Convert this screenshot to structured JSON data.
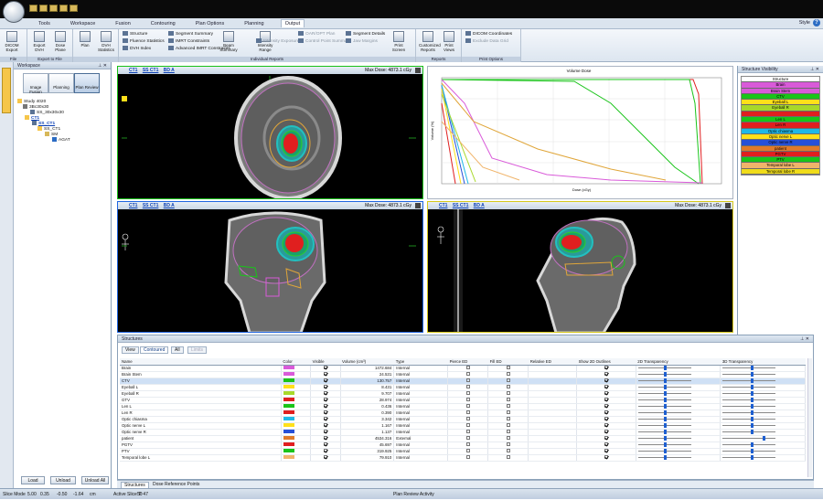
{
  "titlebar": {
    "qat_icons": [
      "save-icon",
      "open-icon",
      "undo-icon",
      "redo-icon",
      "print-icon"
    ]
  },
  "menu": {
    "tabs": [
      "Tools",
      "Workspace",
      "Fusion",
      "Contouring",
      "Plan Options",
      "Planning",
      "Output"
    ],
    "active": "Output",
    "style_label": "Style",
    "help": "?"
  },
  "ribbon": {
    "groups": [
      {
        "label": "File",
        "buttons": [
          "DICOM Export"
        ]
      },
      {
        "label": "Export to File",
        "buttons": [
          "Export DVH",
          "Dose Plane"
        ]
      },
      {
        "label": "",
        "buttons": [
          "Plan",
          "DVH Statistics"
        ]
      },
      {
        "label": "Individual Reports",
        "small": [
          "Structure",
          "Fluence Statistics",
          "DVH Index",
          "Segment Summary",
          "IMRT Constraints",
          "Advanced IMRT Constraints",
          "Beam Summary",
          "Intensity Range",
          "Intensity Exposure",
          "OAR/OPT Plan",
          "Control Point Summary",
          "Segment Details",
          "Jaw Margins",
          "Print Screen"
        ]
      },
      {
        "label": "Reports",
        "buttons": [
          "Customized Reports",
          "Print Views"
        ]
      },
      {
        "label": "Print Options",
        "small": [
          "DICOM Coordinates",
          "Exclude Data Grid"
        ]
      }
    ]
  },
  "workspace": {
    "title": "Workspace",
    "modes": [
      "Image Fusion",
      "Planning",
      "Plan Review"
    ],
    "active_mode": "Plan Review",
    "tree": [
      "Study 4020",
      "3Bc30x30",
      "SS_30x30x30",
      "CT1",
      "SS_CT1",
      "SS_CT1",
      "SM",
      "AGAT"
    ],
    "footer": [
      "Load",
      "Unload",
      "Unload All"
    ]
  },
  "views": {
    "axial": {
      "links": [
        "CT1",
        "SS CT1",
        "BD A"
      ],
      "max_dose": "Max Dose: 4873.1 cGy"
    },
    "coronal": {
      "links": [
        "CT1",
        "SS CT1",
        "BD A"
      ],
      "max_dose": "Max Dose: 4873.1 cGy"
    },
    "sagittal": {
      "links": [
        "CT1",
        "SS CT1",
        "BD A"
      ],
      "max_dose": "Max Dose: 4873.1 cGy"
    }
  },
  "dvh": {
    "title": "Volume Dose",
    "x_label": "Dose (cGy)",
    "y_label": "Volume (%)"
  },
  "structure_visibility": {
    "title": "Structure Visibility",
    "header": "Structure",
    "rows": [
      {
        "name": "Brain",
        "color": "#d95ad9"
      },
      {
        "name": "Brain Stem",
        "color": "#d95ad9"
      },
      {
        "name": "CTV",
        "color": "#19c419"
      },
      {
        "name": "Eyeball L",
        "color": "#ffe01a"
      },
      {
        "name": "Eyeball R",
        "color": "#a8d82a"
      },
      {
        "name": "",
        "color": "#e01f1f"
      },
      {
        "name": "Len L",
        "color": "#19c419"
      },
      {
        "name": "Len R",
        "color": "#e01f1f"
      },
      {
        "name": "Optic chiasma",
        "color": "#1fb8e6"
      },
      {
        "name": "Optic nerve L",
        "color": "#ffe01a"
      },
      {
        "name": "Optic nerve R",
        "color": "#2650d8"
      },
      {
        "name": "patient",
        "color": "#e07a2a"
      },
      {
        "name": "PGTV",
        "color": "#e01f1f"
      },
      {
        "name": "PTV",
        "color": "#19c419"
      },
      {
        "name": "Temporal lobe L",
        "color": "#f0b46a"
      },
      {
        "name": "Temporal lobe R",
        "color": "#f0dc1a"
      }
    ]
  },
  "structures": {
    "title": "Structures",
    "tabs": [
      "View",
      "Contoured",
      "All",
      "Limits"
    ],
    "active_tab": "Contoured",
    "columns": [
      "Name",
      "Color",
      "Visible",
      "Volume (cm³)",
      "Type",
      "Pierce ED",
      "Fill ED",
      "Relative ED",
      "Show 2D Outlines",
      "2D Transparency",
      "3D Transparency"
    ],
    "rows": [
      {
        "name": "Brain",
        "color": "#d95ad9",
        "vol": "1472.684",
        "type": "Internal",
        "t2": 0.52,
        "t3": 0.55
      },
      {
        "name": "Brain Stem",
        "color": "#d95ad9",
        "vol": "24.531",
        "type": "Internal",
        "t2": 0.52,
        "t3": 0.55
      },
      {
        "name": "CTV",
        "color": "#19c419",
        "vol": "130.757",
        "type": "Internal",
        "t2": 0.52,
        "t3": 0.55
      },
      {
        "name": "Eyeball L",
        "color": "#ffe01a",
        "vol": "8.431",
        "type": "Internal",
        "t2": 0.52,
        "t3": 0.55
      },
      {
        "name": "Eyeball R",
        "color": "#a8d82a",
        "vol": "9.707",
        "type": "Internal",
        "t2": 0.52,
        "t3": 0.55
      },
      {
        "name": "GTV",
        "color": "#e01f1f",
        "vol": "28.974",
        "type": "Internal",
        "t2": 0.52,
        "t3": 0.55
      },
      {
        "name": "Len L",
        "color": "#19c419",
        "vol": "0.436",
        "type": "Internal",
        "t2": 0.52,
        "t3": 0.55
      },
      {
        "name": "Len R",
        "color": "#e01f1f",
        "vol": "0.390",
        "type": "Internal",
        "t2": 0.52,
        "t3": 0.55
      },
      {
        "name": "Optic chiasma",
        "color": "#1fb8e6",
        "vol": "3.342",
        "type": "Internal",
        "t2": 0.52,
        "t3": 0.55
      },
      {
        "name": "Optic nerve L",
        "color": "#ffe01a",
        "vol": "1.167",
        "type": "Internal",
        "t2": 0.52,
        "t3": 0.55
      },
      {
        "name": "Optic nerve R",
        "color": "#2650d8",
        "vol": "1.137",
        "type": "Internal",
        "t2": 0.52,
        "t3": 0.55
      },
      {
        "name": "patient",
        "color": "#e07a2a",
        "vol": "4534.316",
        "type": "External",
        "t2": 0.52,
        "t3": 0.8
      },
      {
        "name": "PGTV",
        "color": "#e01f1f",
        "vol": "45.697",
        "type": "Internal",
        "t2": 0.52,
        "t3": 0.55
      },
      {
        "name": "PTV",
        "color": "#19c419",
        "vol": "319.925",
        "type": "Internal",
        "t2": 0.52,
        "t3": 0.55
      },
      {
        "name": "Temporal lobe L",
        "color": "#f0b46a",
        "vol": "79.910",
        "type": "Internal",
        "t2": 0.52,
        "t3": 0.55
      }
    ],
    "bottom_tabs": [
      "Structures",
      "Dose Reference Points"
    ]
  },
  "status": {
    "slice_mode": "Slice Mode",
    "fields": [
      "5.00",
      "0.35",
      "-0.50",
      "-1.64",
      "cm",
      "Active Slice T: 47",
      "50"
    ],
    "activity": "Plan Review Activity"
  }
}
